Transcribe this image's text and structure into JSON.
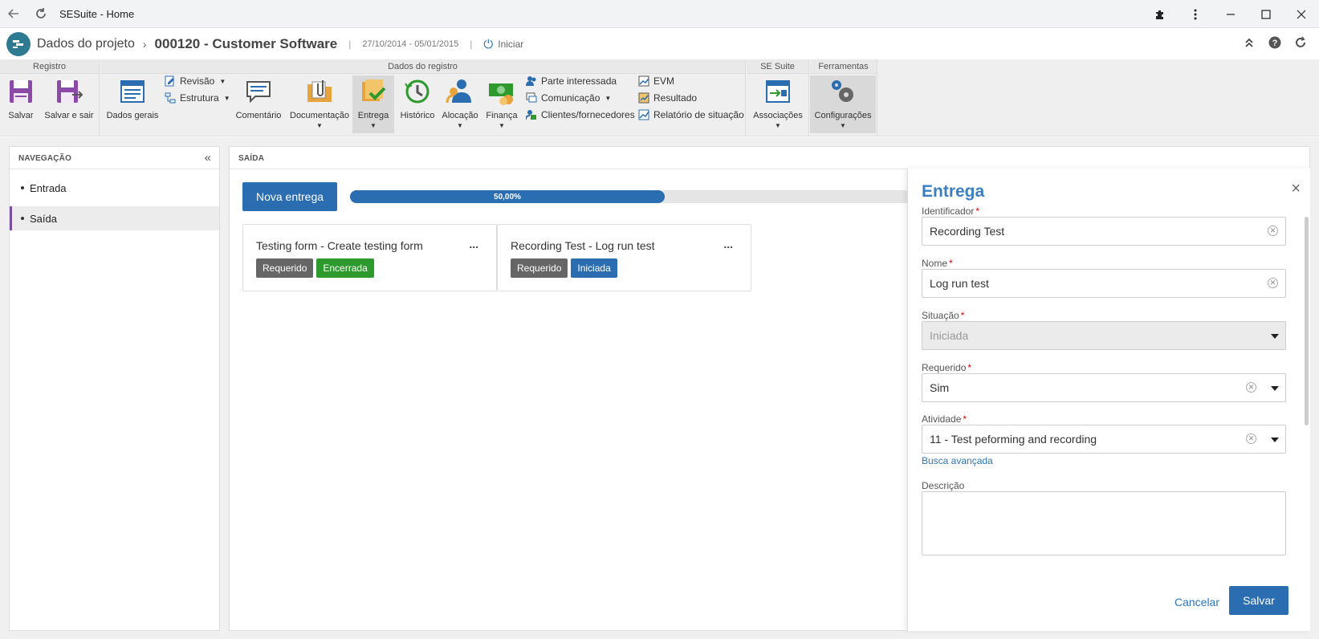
{
  "browser": {
    "tab_title": "SESuite - Home"
  },
  "header": {
    "breadcrumb_root": "Dados do projeto",
    "title": "000120 - Customer Software",
    "sep": "|",
    "dates": "27/10/2014 - 05/01/2015",
    "start_label": "Iniciar"
  },
  "ribbon": {
    "groups": {
      "registro": "Registro",
      "dados": "Dados do registro",
      "sesuite": "SE Suite",
      "ferramentas": "Ferramentas"
    },
    "salvar": "Salvar",
    "salvar_sair": "Salvar e sair",
    "dados_gerais": "Dados gerais",
    "revisao": "Revisão",
    "estrutura": "Estrutura",
    "comentario": "Comentário",
    "documentacao": "Documentação",
    "entrega": "Entrega",
    "historico": "Histórico",
    "alocacao": "Alocação",
    "financa": "Finança",
    "parte_interessada": "Parte interessada",
    "comunicacao": "Comunicação",
    "clientes": "Clientes/fornecedores",
    "evm": "EVM",
    "resultado": "Resultado",
    "relatorio": "Relatório de situação",
    "associacoes": "Associações",
    "configuracoes": "Configurações"
  },
  "nav": {
    "title": "NAVEGAÇÃO",
    "items": [
      {
        "label": "Entrada"
      },
      {
        "label": "Saída"
      }
    ]
  },
  "output": {
    "title": "SAÍDA",
    "new_button": "Nova entrega",
    "progress_label": "50,00%",
    "progress_value": 0.5,
    "cards": [
      {
        "title": "Testing form - Create testing form",
        "more": "...",
        "badge1": "Requerido",
        "badge2": "Encerrada"
      },
      {
        "title": "Recording Test - Log run test",
        "more": "...",
        "badge1": "Requerido",
        "badge2": "Iniciada"
      }
    ]
  },
  "form": {
    "title": "Entrega",
    "close": "×",
    "identificador_label": "Identificador",
    "identificador_value": "Recording Test",
    "nome_label": "Nome",
    "nome_value": "Log run test",
    "situacao_label": "Situação",
    "situacao_value": "Iniciada",
    "requerido_label": "Requerido",
    "requerido_value": "Sim",
    "atividade_label": "Atividade",
    "atividade_value": "11 - Test peforming and recording",
    "busca": "Busca avançada",
    "descricao_label": "Descrição",
    "req_mark": "*",
    "cancel": "Cancelar",
    "save": "Salvar"
  },
  "colors": {
    "primary": "#2a6db0",
    "accent_title": "#3a7fc1",
    "nav_marker": "#7a4da0",
    "badge_closed": "#2e9a2e",
    "badge_gray": "#666666"
  }
}
